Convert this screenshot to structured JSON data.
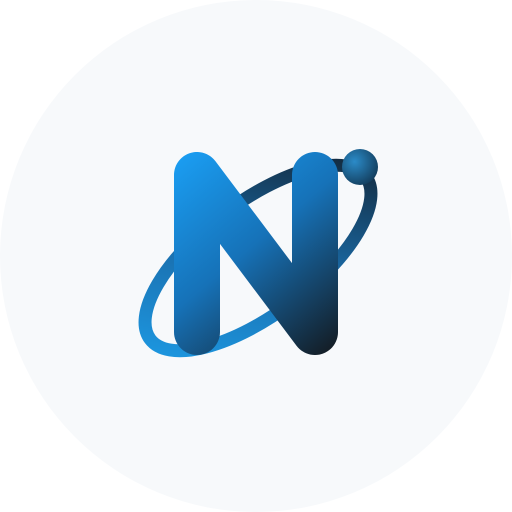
{
  "icon": {
    "name": "n-orbit-logo-icon",
    "colors": {
      "page_background": "#ffffff",
      "circle_background": "#f7f9fb",
      "gradient_start": "#1a9cf0",
      "gradient_mid": "#1672b8",
      "gradient_end": "#141a20",
      "orbit_light": "#1d9de8",
      "orbit_dark": "#121b25",
      "dot_light": "#2b8bc8",
      "dot_dark": "#123a58"
    }
  }
}
